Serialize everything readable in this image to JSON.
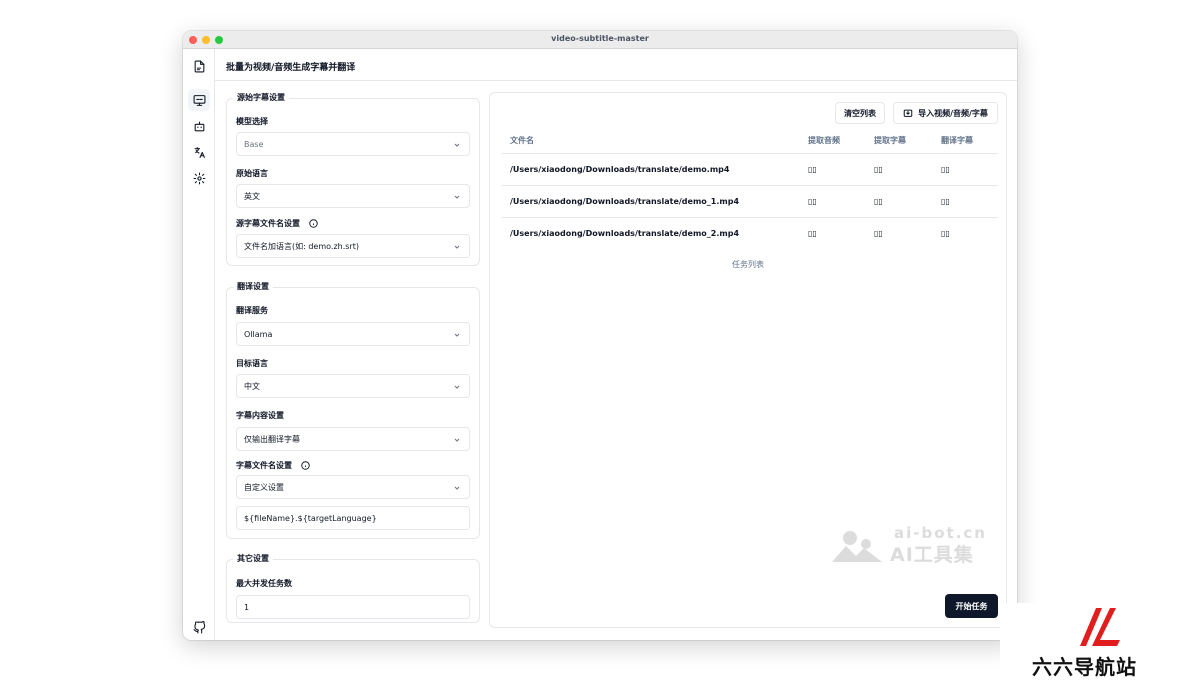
{
  "window": {
    "title": "video-subtitle-master"
  },
  "header": {
    "title": "批量为视频/音频生成字幕并翻译"
  },
  "source_settings": {
    "legend": "源始字幕设置",
    "model_label": "模型选择",
    "model_placeholder": "Base",
    "language_label": "原始语言",
    "language_value": "英文",
    "filename_label": "源字幕文件名设置",
    "filename_value": "文件名加语言(如: demo.zh.srt)"
  },
  "translate_settings": {
    "legend": "翻译设置",
    "service_label": "翻译服务",
    "service_value": "Ollama",
    "target_label": "目标语言",
    "target_value": "中文",
    "content_label": "字幕内容设置",
    "content_value": "仅输出翻译字幕",
    "filename_label": "字幕文件名设置",
    "filename_value": "自定义设置",
    "template_value": "${fileName}.${targetLanguage}"
  },
  "other_settings": {
    "legend": "其它设置",
    "concurrency_label": "最大并发任务数",
    "concurrency_value": "1"
  },
  "toolbar": {
    "clear_label": "清空列表",
    "import_label": "导入视频/音频/字幕"
  },
  "table": {
    "headers": [
      "文件名",
      "提取音频",
      "提取字幕",
      "翻译字幕"
    ],
    "rows": [
      {
        "file": "/Users/xiaodong/Downloads/translate/demo.mp4",
        "audio": "▯▯",
        "extract": "▯▯",
        "translate": "▯▯"
      },
      {
        "file": "/Users/xiaodong/Downloads/translate/demo_1.mp4",
        "audio": "▯▯",
        "extract": "▯▯",
        "translate": "▯▯"
      },
      {
        "file": "/Users/xiaodong/Downloads/translate/demo_2.mp4",
        "audio": "▯▯",
        "extract": "▯▯",
        "translate": "▯▯"
      }
    ],
    "caption": "任务列表"
  },
  "start_button": {
    "label": "开始任务"
  },
  "watermark": {
    "line1": "ai-bot.cn",
    "line2": "AI工具集"
  },
  "brand": {
    "text": "六六导航站"
  },
  "colors": {
    "primary_dark": "#0f172a",
    "border": "#e5e7eb",
    "brand_red": "#e11d1d"
  },
  "icons": [
    "file-audio-icon",
    "subtitle-screen-icon",
    "bot-icon",
    "translate-icon",
    "gear-icon",
    "github-icon",
    "chevron-down-icon",
    "info-icon",
    "import-icon"
  ]
}
